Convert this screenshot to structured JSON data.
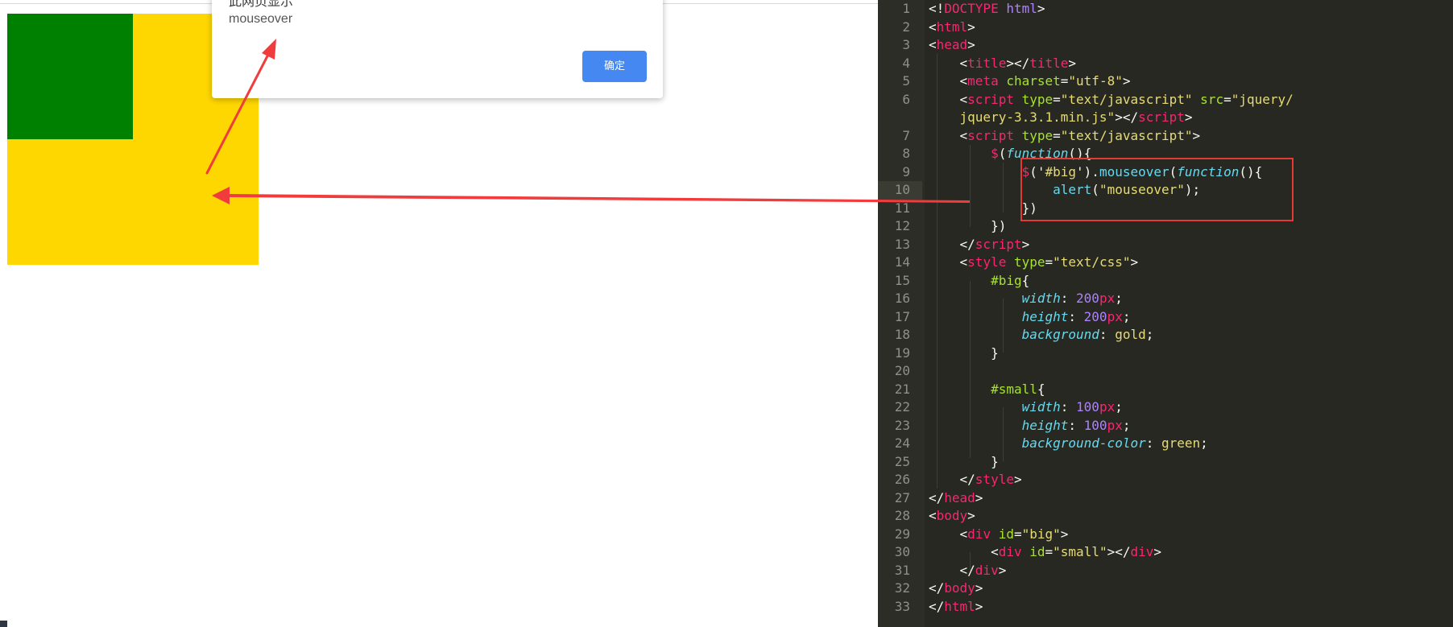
{
  "browser": {
    "alert": {
      "title": "此网页显示",
      "message": "mouseover",
      "ok_label": "确定"
    },
    "big_box_color": "#ffd700",
    "small_box_color": "#008000"
  },
  "editor": {
    "highlighted_line": 10,
    "lines": [
      {
        "n": "1"
      },
      {
        "n": "2"
      },
      {
        "n": "3"
      },
      {
        "n": "4"
      },
      {
        "n": "5"
      },
      {
        "n": "6"
      },
      {
        "n": "7"
      },
      {
        "n": "8"
      },
      {
        "n": "9"
      },
      {
        "n": "10"
      },
      {
        "n": "11"
      },
      {
        "n": "12"
      },
      {
        "n": "13"
      },
      {
        "n": "14"
      },
      {
        "n": "15"
      },
      {
        "n": "16"
      },
      {
        "n": "17"
      },
      {
        "n": "18"
      },
      {
        "n": "19"
      },
      {
        "n": "20"
      },
      {
        "n": "21"
      },
      {
        "n": "22"
      },
      {
        "n": "23"
      },
      {
        "n": "24"
      },
      {
        "n": "25"
      },
      {
        "n": "26"
      },
      {
        "n": "27"
      },
      {
        "n": "28"
      },
      {
        "n": "29"
      },
      {
        "n": "30"
      },
      {
        "n": "31"
      },
      {
        "n": "32"
      },
      {
        "n": "33"
      }
    ],
    "code": {
      "l1_a": "<!",
      "l1_b": "DOCTYPE",
      "l1_c": " html",
      "l1_d": ">",
      "l2_a": "<",
      "l2_b": "html",
      "l2_c": ">",
      "l3_a": "<",
      "l3_b": "head",
      "l3_c": ">",
      "l4_a": "<",
      "l4_b": "title",
      "l4_c": "></",
      "l4_d": "title",
      "l4_e": ">",
      "l5_a": "<",
      "l5_b": "meta",
      "l5_c": " charset",
      "l5_d": "=",
      "l5_e": "\"utf-8\"",
      "l5_f": ">",
      "l6_a": "<",
      "l6_b": "script",
      "l6_c": " type",
      "l6_d": "=",
      "l6_e": "\"text/javascript\"",
      "l6_f": " src",
      "l6_g": "=",
      "l6_h": "\"jquery/",
      "l6w": "jquery-3.3.1.min.js\"",
      "l6w_b": "></",
      "l6w_c": "script",
      "l6w_d": ">",
      "l7_a": "<",
      "l7_b": "script",
      "l7_c": " type",
      "l7_d": "=",
      "l7_e": "\"text/javascript\"",
      "l7_f": ">",
      "l8_a": "$",
      "l8_b": "(",
      "l8_c": "function",
      "l8_d": "(){",
      "l9_a": "$",
      "l9_b": "('",
      "l9_c": "#big",
      "l9_d": "').",
      "l9_e": "mouseover",
      "l9_f": "(",
      "l9_g": "function",
      "l9_h": "(){",
      "l10_a": "alert",
      "l10_b": "(",
      "l10_c": "\"mouseover\"",
      "l10_d": ");",
      "l11_a": "})",
      "l12_a": "})",
      "l13_a": "</",
      "l13_b": "script",
      "l13_c": ">",
      "l14_a": "<",
      "l14_b": "style",
      "l14_c": " type",
      "l14_d": "=",
      "l14_e": "\"text/css\"",
      "l14_f": ">",
      "l15_a": "#big",
      "l15_b": "{",
      "l16_a": "width",
      "l16_b": ": ",
      "l16_c": "200",
      "l16_d": "px",
      "l16_e": ";",
      "l17_a": "height",
      "l17_b": ": ",
      "l17_c": "200",
      "l17_d": "px",
      "l17_e": ";",
      "l18_a": "background",
      "l18_b": ": ",
      "l18_c": "gold",
      "l18_d": ";",
      "l19_a": "}",
      "l21_a": "#small",
      "l21_b": "{",
      "l22_a": "width",
      "l22_b": ": ",
      "l22_c": "100",
      "l22_d": "px",
      "l22_e": ";",
      "l23_a": "height",
      "l23_b": ": ",
      "l23_c": "100",
      "l23_d": "px",
      "l23_e": ";",
      "l24_a": "background-color",
      "l24_b": ": ",
      "l24_c": "green",
      "l24_d": ";",
      "l25_a": "}",
      "l26_a": "</",
      "l26_b": "style",
      "l26_c": ">",
      "l27_a": "</",
      "l27_b": "head",
      "l27_c": ">",
      "l28_a": "<",
      "l28_b": "body",
      "l28_c": ">",
      "l29_a": "<",
      "l29_b": "div",
      "l29_c": " id",
      "l29_d": "=",
      "l29_e": "\"big\"",
      "l29_f": ">",
      "l30_a": "<",
      "l30_b": "div",
      "l30_c": " id",
      "l30_d": "=",
      "l30_e": "\"small\"",
      "l30_f": "></",
      "l30_g": "div",
      "l30_h": ">",
      "l31_a": "</",
      "l31_b": "div",
      "l31_c": ">",
      "l32_a": "</",
      "l32_b": "body",
      "l32_c": ">",
      "l33_a": "</",
      "l33_b": "html",
      "l33_c": ">"
    }
  },
  "annotation": {
    "arrow_color": "#f03c3c",
    "box_color": "#e53935"
  }
}
